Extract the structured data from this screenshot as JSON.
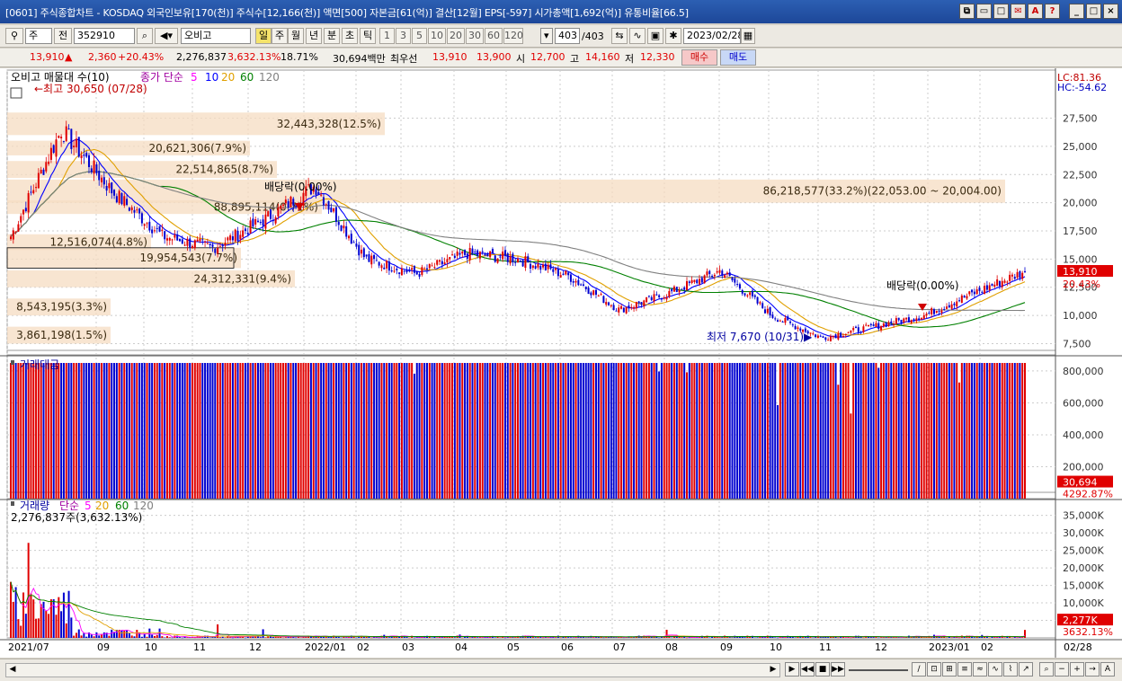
{
  "window": {
    "title": "[0601] 주식종합차트 - KOSDAQ 외국인보유[170(천)] 주식수[12,166(천)] 액면[500] 자본금[61(억)] 결산[12월] EPS[-597] 시가총액[1,692(억)] 유통비율[66.5]"
  },
  "toolbar": {
    "market_select": "주",
    "prev_label": "전",
    "stock_code": "352910",
    "stock_name": "오비고",
    "period_buttons": [
      "일",
      "주",
      "월",
      "년",
      "분",
      "초",
      "틱"
    ],
    "active_period": "일",
    "interval_buttons": [
      "1",
      "3",
      "5",
      "10",
      "20",
      "30",
      "60",
      "120"
    ],
    "count": "403",
    "count_total": "/403",
    "date": "2023/02/28"
  },
  "info": {
    "price": "13,910",
    "change": "2,360",
    "change_pct": "+20.43%",
    "volume": "2,276,837",
    "volume_ratio": "3,632.13%",
    "turnover": "18.71%",
    "amount": "30,694백만",
    "bid_label": "최우선",
    "bid1": "13,910",
    "bid2": "13,900",
    "open_label": "시",
    "open": "12,700",
    "high_label": "고",
    "high": "14,160",
    "low_label": "저",
    "low": "12,330",
    "buy_label": "매수",
    "sell_label": "매도"
  },
  "price_panel": {
    "legend_name": "오비고 매물대 수(10)",
    "legend_ma_label": "종가 단순",
    "ma_periods": [
      "5",
      "10",
      "20",
      "60",
      "120"
    ],
    "ma_colors": [
      "#ff00ff",
      "#0000ff",
      "#e0a000",
      "#008000",
      "#808080"
    ],
    "high_marker": "최고 30,650 (07/28)",
    "low_marker": "최저 7,670 (10/31)",
    "dividend_label_1": "배당락(0.00%)",
    "dividend_label_2": "배당락(0.00%)",
    "lc_label": "LC:81.36",
    "hc_label": "HC:-54.62",
    "last_price_tag": "13,910",
    "last_pct_tag": "20.43%",
    "y_ticks": [
      "27,500",
      "25,000",
      "22,500",
      "20,000",
      "17,500",
      "15,000",
      "12,500",
      "10,000",
      "7,500"
    ],
    "volume_profile": [
      {
        "label": "32,443,328(12.5%)"
      },
      {
        "label": "20,621,306(7.9%)"
      },
      {
        "label": "22,514,865(8.7%)"
      },
      {
        "label": "86,218,577(33.2%)(22,053.00 ~ 20,004.00)"
      },
      {
        "label": "88,895,114(0.71%)"
      },
      {
        "label": "12,516,074(4.8%)"
      },
      {
        "label": "19,954,543(7.7%)"
      },
      {
        "label": "24,312,331(9.4%)"
      },
      {
        "label": "8,543,195(3.3%)"
      },
      {
        "label": "3,861,198(1.5%)"
      }
    ]
  },
  "amount_panel": {
    "title": "거래대금",
    "y_ticks": [
      "800,000",
      "600,000",
      "400,000",
      "200,000"
    ],
    "last_tag": "30,694",
    "last_pct": "4292.87%"
  },
  "volume_panel": {
    "title": "거래량",
    "ma_label": "단순",
    "ma_periods": [
      "5",
      "20",
      "60",
      "120"
    ],
    "sub_label": "2,276,837주(3,632.13%)",
    "y_ticks": [
      "35,000K",
      "30,000K",
      "25,000K",
      "20,000K",
      "15,000K",
      "10,000K",
      "5,000K"
    ],
    "last_tag": "2,277K",
    "last_pct": "3632.13%"
  },
  "x_axis": {
    "labels": [
      "2021/07",
      "09",
      "10",
      "11",
      "12",
      "2022/01",
      "02",
      "03",
      "04",
      "05",
      "06",
      "07",
      "08",
      "09",
      "10",
      "11",
      "12",
      "2023/01",
      "02"
    ],
    "right_label": "02/28"
  },
  "chart_data": {
    "type": "line",
    "title": "",
    "xlabel": "",
    "ylabel": "",
    "ylim": [
      6500,
      30650
    ],
    "x": [
      "2021/07",
      "2021/08",
      "2021/09",
      "2021/10",
      "2021/11",
      "2021/12",
      "2022/01",
      "2022/02",
      "2022/03",
      "2022/04",
      "2022/05",
      "2022/06",
      "2022/07",
      "2022/08",
      "2022/09",
      "2022/10",
      "2022/11",
      "2022/12",
      "2023/01",
      "2023/02",
      "2023/02/28"
    ],
    "series": [
      {
        "name": "종가",
        "values": [
          17000,
          26500,
          21000,
          17000,
          16000,
          18500,
          21500,
          15000,
          13700,
          15500,
          15000,
          13500,
          10500,
          12000,
          14000,
          10000,
          8000,
          9000,
          10000,
          12000,
          13910
        ]
      }
    ]
  }
}
